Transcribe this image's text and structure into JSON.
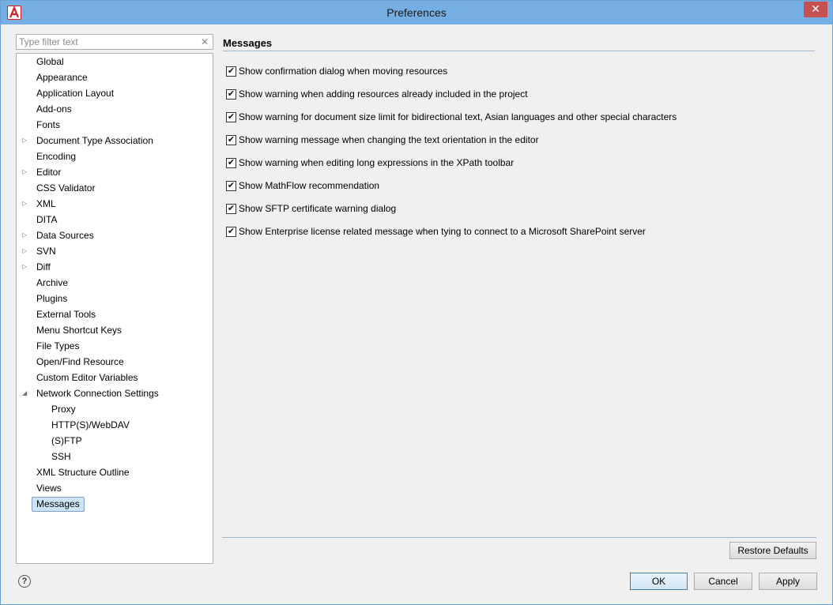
{
  "window": {
    "title": "Preferences",
    "close_glyph": "✕"
  },
  "filter": {
    "placeholder": "Type filter text",
    "clear_glyph": "✕"
  },
  "tree": {
    "items": [
      {
        "label": "Global"
      },
      {
        "label": "Appearance"
      },
      {
        "label": "Application Layout"
      },
      {
        "label": "Add-ons"
      },
      {
        "label": "Fonts"
      },
      {
        "label": "Document Type Association",
        "expander": "▷"
      },
      {
        "label": "Encoding"
      },
      {
        "label": "Editor",
        "expander": "▷"
      },
      {
        "label": "CSS Validator"
      },
      {
        "label": "XML",
        "expander": "▷"
      },
      {
        "label": "DITA"
      },
      {
        "label": "Data Sources",
        "expander": "▷"
      },
      {
        "label": "SVN",
        "expander": "▷"
      },
      {
        "label": "Diff",
        "expander": "▷"
      },
      {
        "label": "Archive"
      },
      {
        "label": "Plugins"
      },
      {
        "label": "External Tools"
      },
      {
        "label": "Menu Shortcut Keys"
      },
      {
        "label": "File Types"
      },
      {
        "label": "Open/Find Resource"
      },
      {
        "label": "Custom Editor Variables"
      },
      {
        "label": "Network Connection Settings",
        "expander": "◢"
      },
      {
        "label": "Proxy"
      },
      {
        "label": "HTTP(S)/WebDAV"
      },
      {
        "label": "(S)FTP"
      },
      {
        "label": "SSH"
      },
      {
        "label": "XML Structure Outline"
      },
      {
        "label": "Views"
      },
      {
        "label": "Messages"
      }
    ],
    "selected": "Messages"
  },
  "messages": {
    "title": "Messages",
    "check_glyph": "✔",
    "options": [
      {
        "label": "Show confirmation dialog when moving resources",
        "checked": true
      },
      {
        "label": "Show warning when adding resources already included in the project",
        "checked": true
      },
      {
        "label": "Show warning for document size limit for bidirectional text, Asian languages and other special characters",
        "checked": true
      },
      {
        "label": "Show warning message when changing the text orientation in the editor",
        "checked": true
      },
      {
        "label": "Show warning when editing long expressions in the XPath toolbar",
        "checked": true
      },
      {
        "label": "Show MathFlow recommendation",
        "checked": true
      },
      {
        "label": "Show SFTP certificate warning dialog",
        "checked": true
      },
      {
        "label": "Show Enterprise license related message when tying to connect to a Microsoft SharePoint server",
        "checked": true
      }
    ]
  },
  "buttons": {
    "restore_defaults": "Restore Defaults",
    "ok": "OK",
    "cancel": "Cancel",
    "apply": "Apply",
    "help_glyph": "?"
  }
}
